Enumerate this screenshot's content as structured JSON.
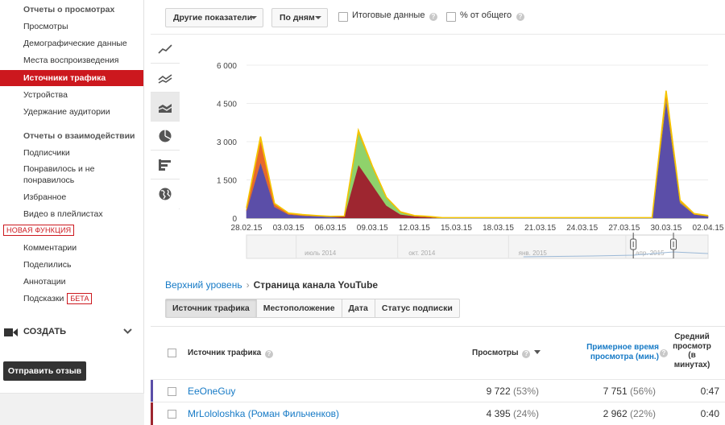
{
  "sidebar": {
    "items": [
      {
        "label": "Отчеты о просмотрах",
        "type": "head"
      },
      {
        "label": "Просмотры"
      },
      {
        "label": "Демографические данные"
      },
      {
        "label": "Места воспроизведения"
      },
      {
        "label": "Источники трафика",
        "active": true
      },
      {
        "label": "Устройства"
      },
      {
        "label": "Удержание аудитории"
      },
      {
        "label": "Отчеты о взаимодействии",
        "type": "head"
      },
      {
        "label": "Подписчики"
      },
      {
        "label": "Понравилось и не понравилось"
      },
      {
        "label": "Избранное"
      },
      {
        "label": "Видео в плейлистах"
      },
      {
        "label": "Комментарии"
      },
      {
        "label": "Поделились"
      },
      {
        "label": "Аннотации"
      },
      {
        "label": "Подсказки"
      }
    ],
    "new_feature_badge": "НОВАЯ ФУНКЦИЯ",
    "beta_badge": "БЕТА",
    "create_label": "СОЗДАТЬ",
    "feedback_button": "Отправить отзыв"
  },
  "toolbar": {
    "metrics_dropdown": "Другие показатели",
    "period_dropdown": "По дням",
    "totals_checkbox": "Итоговые данные",
    "percent_checkbox": "% от общего"
  },
  "chart_types": [
    "line-chart-icon",
    "multi-line-chart-icon",
    "stacked-area-chart-icon",
    "pie-chart-icon",
    "bar-chart-icon",
    "map-icon"
  ],
  "chart_data": {
    "type": "area",
    "stacked": true,
    "x": [
      "28.02.15",
      "01.03.15",
      "02.03.15",
      "03.03.15",
      "04.03.15",
      "05.03.15",
      "06.03.15",
      "07.03.15",
      "08.03.15",
      "09.03.15",
      "10.03.15",
      "11.03.15",
      "12.03.15",
      "13.03.15",
      "14.03.15",
      "15.03.15",
      "16.03.15",
      "17.03.15",
      "18.03.15",
      "19.03.15",
      "20.03.15",
      "21.03.15",
      "22.03.15",
      "23.03.15",
      "24.03.15",
      "25.03.15",
      "26.03.15",
      "27.03.15",
      "28.03.15",
      "29.03.15",
      "30.03.15",
      "31.03.15",
      "01.04.15",
      "02.04.15"
    ],
    "x_tick_labels": [
      "28.02.15",
      "03.03.15",
      "06.03.15",
      "09.03.15",
      "12.03.15",
      "15.03.15",
      "18.03.15",
      "21.03.15",
      "24.03.15",
      "27.03.15",
      "30.03.15",
      "02.04.15"
    ],
    "y_tick_labels": [
      "0",
      "1 500",
      "3 000",
      "4 500",
      "6 000"
    ],
    "ylim": [
      0,
      6000
    ],
    "series": [
      {
        "color": "#5b4ea8",
        "values": [
          300,
          2200,
          450,
          150,
          100,
          80,
          60,
          0,
          0,
          0,
          0,
          0,
          0,
          0,
          0,
          0,
          0,
          0,
          0,
          0,
          0,
          0,
          0,
          0,
          0,
          0,
          0,
          0,
          0,
          0,
          4600,
          600,
          150,
          80
        ]
      },
      {
        "color": "#9e2630",
        "values": [
          0,
          0,
          0,
          0,
          0,
          0,
          0,
          80,
          2100,
          1300,
          500,
          150,
          80,
          50,
          0,
          0,
          0,
          0,
          0,
          0,
          0,
          0,
          0,
          0,
          0,
          0,
          0,
          0,
          0,
          0,
          0,
          0,
          0,
          0
        ]
      },
      {
        "color": "#8fd26b",
        "values": [
          0,
          0,
          0,
          0,
          0,
          0,
          0,
          0,
          1250,
          700,
          300,
          80,
          0,
          0,
          0,
          0,
          0,
          0,
          0,
          0,
          0,
          0,
          0,
          0,
          0,
          0,
          0,
          0,
          0,
          0,
          100,
          30,
          0,
          0
        ]
      },
      {
        "color": "#e8692b",
        "values": [
          50,
          850,
          100,
          30,
          20,
          10,
          0,
          0,
          0,
          0,
          0,
          0,
          0,
          0,
          0,
          0,
          0,
          0,
          0,
          0,
          0,
          0,
          0,
          0,
          0,
          0,
          0,
          0,
          0,
          0,
          150,
          30,
          10,
          0
        ]
      },
      {
        "color": "#f5c400",
        "values": [
          50,
          150,
          30,
          20,
          20,
          10,
          10,
          0,
          100,
          40,
          20,
          20,
          20,
          20,
          20,
          20,
          20,
          20,
          20,
          20,
          20,
          20,
          20,
          20,
          20,
          20,
          20,
          20,
          20,
          20,
          150,
          40,
          20,
          20
        ]
      }
    ],
    "navigator_labels": [
      "июль 2014",
      "окт. 2014",
      "янв. 2015",
      "апр. 2015"
    ]
  },
  "breadcrumb": {
    "root": "Верхний уровень",
    "separator": "›",
    "current": "Страница канала YouTube"
  },
  "tabs": [
    {
      "label": "Источник трафика",
      "active": true
    },
    {
      "label": "Местоположение"
    },
    {
      "label": "Дата"
    },
    {
      "label": "Статус подписки"
    }
  ],
  "table": {
    "headers": {
      "source": "Источник трафика",
      "views": "Просмотры",
      "watch_time": "Примерное время просмотра (мин.)",
      "avg_duration": "Средний просмотр (в минутах)"
    },
    "rows": [
      {
        "source": "EeOneGuy",
        "views": "9 722",
        "views_pct": "(53%)",
        "watch": "7 751",
        "watch_pct": "(56%)",
        "avg": "0:47",
        "color": "#5b4ea8"
      },
      {
        "source": "MrLololoshka (Роман Фильченков)",
        "views": "4 395",
        "views_pct": "(24%)",
        "watch": "2 962",
        "watch_pct": "(22%)",
        "avg": "0:40",
        "color": "#9e2630"
      }
    ]
  }
}
